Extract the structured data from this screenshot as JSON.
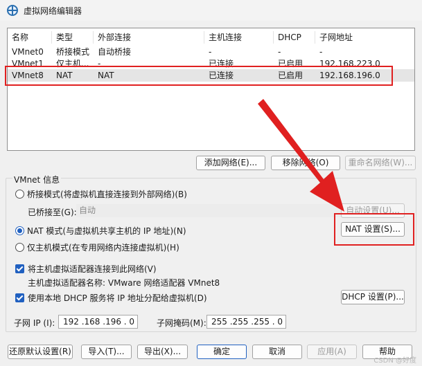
{
  "window": {
    "title": "虚拟网络编辑器"
  },
  "table": {
    "headers": [
      "名称",
      "类型",
      "外部连接",
      "主机连接",
      "DHCP",
      "子网地址"
    ],
    "rows": [
      [
        "VMnet0",
        "桥接模式",
        "自动桥接",
        "-",
        "-",
        "-"
      ],
      [
        "VMnet1",
        "仅主机...",
        "-",
        "已连接",
        "已启用",
        "192.168.223.0"
      ],
      [
        "VMnet8",
        "NAT",
        "NAT",
        "已连接",
        "已启用",
        "192.168.196.0"
      ]
    ]
  },
  "table_buttons": {
    "add": "添加网络(E)...",
    "remove": "移除网络(O)",
    "rename": "重命名网络(W)..."
  },
  "vmnet_info": {
    "label": "VMnet 信息",
    "bridge_mode": "桥接模式(将虚拟机直接连接到外部网络)(B)",
    "bridged_to_label": "已桥接至(G):",
    "bridged_to_value": "自动",
    "auto_settings": "自动设置(U)...",
    "nat_mode": "NAT 模式(与虚拟机共享主机的 IP 地址)(N)",
    "nat_settings": "NAT 设置(S)...",
    "host_only_mode": "仅主机模式(在专用网络内连接虚拟机)(H)",
    "connect_adapter": "将主机虚拟适配器连接到此网络(V)",
    "adapter_name": "主机虚拟适配器名称: VMware 网络适配器 VMnet8",
    "use_dhcp": "使用本地 DHCP 服务将 IP 地址分配给虚拟机(D)",
    "dhcp_settings": "DHCP 设置(P)...",
    "subnet_ip_label": "子网 IP (I):",
    "subnet_ip": "192 .168 .196 . 0",
    "subnet_mask_label": "子网掩码(M):",
    "subnet_mask": "255 .255 .255 . 0"
  },
  "footer": {
    "restore": "还原默认设置(R)",
    "import": "导入(T)...",
    "export": "导出(X)...",
    "ok": "确定",
    "cancel": "取消",
    "apply": "应用(A)",
    "help": "帮助"
  },
  "watermark": "CSDN @好度",
  "colors": {
    "highlight": "#e02020",
    "accent": "#2060c0"
  }
}
